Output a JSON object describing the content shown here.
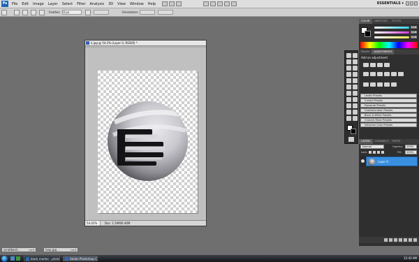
{
  "app": {
    "logo": "Ps",
    "menus": [
      "File",
      "Edit",
      "Image",
      "Layer",
      "Select",
      "Filter",
      "Analysis",
      "3D",
      "View",
      "Window",
      "Help"
    ],
    "workspace": "ESSENTIALS ▾"
  },
  "options_bar": {
    "feather_label": "Feather:",
    "feather_value": "0 px",
    "orientation_label": "Orientation:"
  },
  "document": {
    "title": "k.jpg @ 54.2% (Layer 0, RGB/8) *",
    "zoom": "54.02%",
    "doc_info": "Doc: 1.50M/0.40M"
  },
  "color_panel": {
    "tabs": [
      "COLOR",
      "SWATCHES",
      "STYLES"
    ],
    "slider_values": [
      "255",
      "255",
      "255"
    ],
    "colors": {
      "cyan": "#2fd2ee",
      "magenta": "#d33bd8",
      "yellow": "#f0e84a"
    }
  },
  "adjustments_panel": {
    "tabs": [
      "MASKS",
      "ADJUSTMENTS"
    ],
    "heading": "Add an adjustment",
    "presets": [
      "Levels Presets",
      "Curves Presets",
      "Exposure Presets",
      "Hue/Saturation Presets",
      "Black & White Presets",
      "Channel Mixer Presets",
      "Selective Color Presets"
    ]
  },
  "layers_panel": {
    "tabs": [
      "LAYERS",
      "CHANNELS",
      "PATHS"
    ],
    "blend_mode": "Normal",
    "opacity_label": "Opacity:",
    "opacity_value": "100%",
    "lock_label": "Lock:",
    "fill_label": "Fill:",
    "fill_value": "100%",
    "layers": [
      {
        "name": "Layer 0",
        "selected": true
      }
    ]
  },
  "minimized_windows": [
    "scrollbord...",
    "loop.jpg ..."
  ],
  "taskbar": {
    "tasks": [
      "black marker - photo...",
      "Adobe Photoshop C..."
    ],
    "clock": "12:43 AM"
  }
}
